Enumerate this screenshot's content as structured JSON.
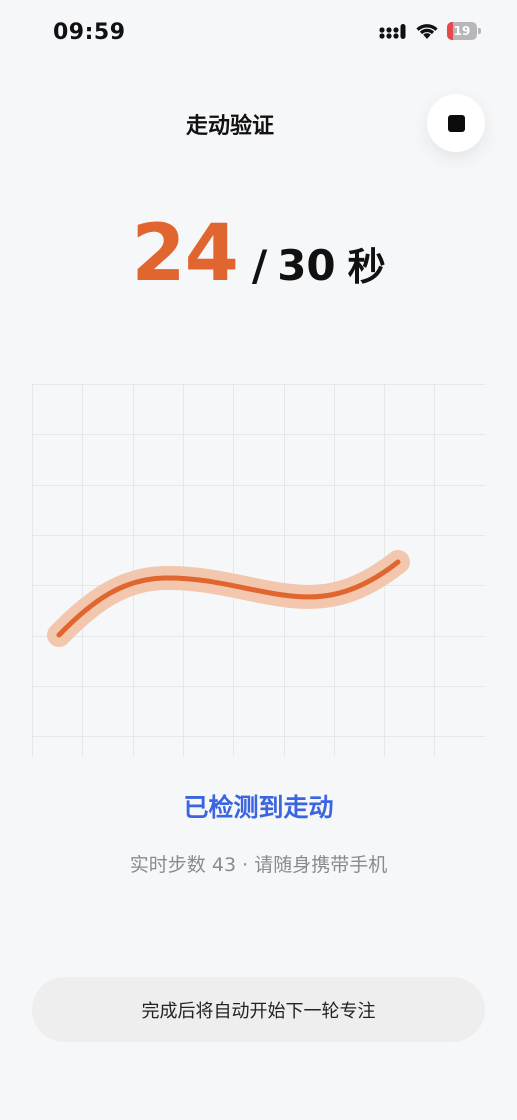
{
  "status_bar": {
    "time": "09:59",
    "battery_level": "19",
    "battery_fraction": 0.19,
    "icons": [
      "cellular-signal-icon",
      "wifi-icon",
      "battery-icon"
    ]
  },
  "header": {
    "title": "走动验证",
    "stop_icon": "stop-icon"
  },
  "timer": {
    "elapsed": "24",
    "separator": "/",
    "total": "30",
    "unit": "秒"
  },
  "motion_chart": {
    "grid": true,
    "line_color": "#e0652e",
    "glow_color": "#f2c7ae"
  },
  "detection": {
    "status": "已检测到走动",
    "steps_prefix": "实时步数",
    "steps_count": "43",
    "steps_separator": "·",
    "steps_hint": "请随身携带手机"
  },
  "footer": {
    "message": "完成后将自动开始下一轮专注"
  },
  "colors": {
    "accent": "#e0652e",
    "status_blue": "#3b64e0",
    "background": "#f6f7f9"
  }
}
